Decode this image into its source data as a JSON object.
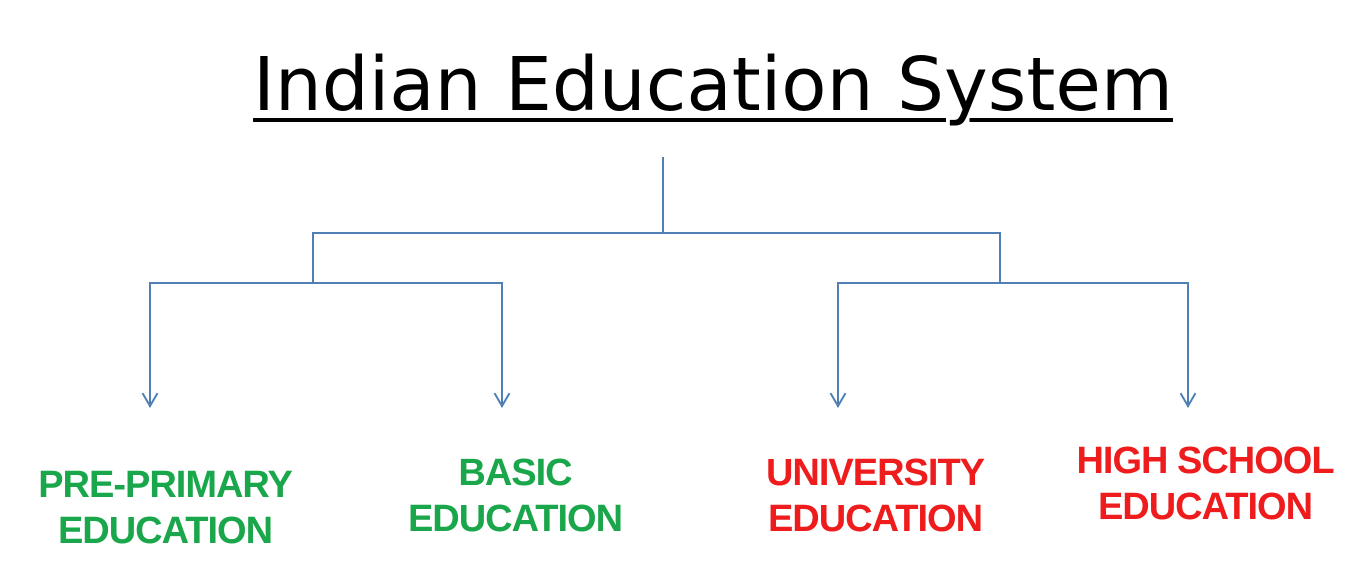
{
  "title": "Indian Education System",
  "colors": {
    "connector": "#4f7fb3",
    "green_label": "#1aa64b",
    "red_label": "#ee1c1c",
    "title": "#000000"
  },
  "nodes": [
    {
      "id": "pre-primary",
      "lines": [
        "PRE-PRIMARY",
        "EDUCATION"
      ],
      "color": "#1aa64b"
    },
    {
      "id": "basic",
      "lines": [
        "BASIC",
        "EDUCATION"
      ],
      "color": "#1aa64b"
    },
    {
      "id": "university",
      "lines": [
        "UNIVERSITY",
        "EDUCATION"
      ],
      "color": "#ee1c1c"
    },
    {
      "id": "high-school",
      "lines": [
        "HIGH SCHOOL",
        "EDUCATION"
      ],
      "color": "#ee1c1c"
    }
  ]
}
